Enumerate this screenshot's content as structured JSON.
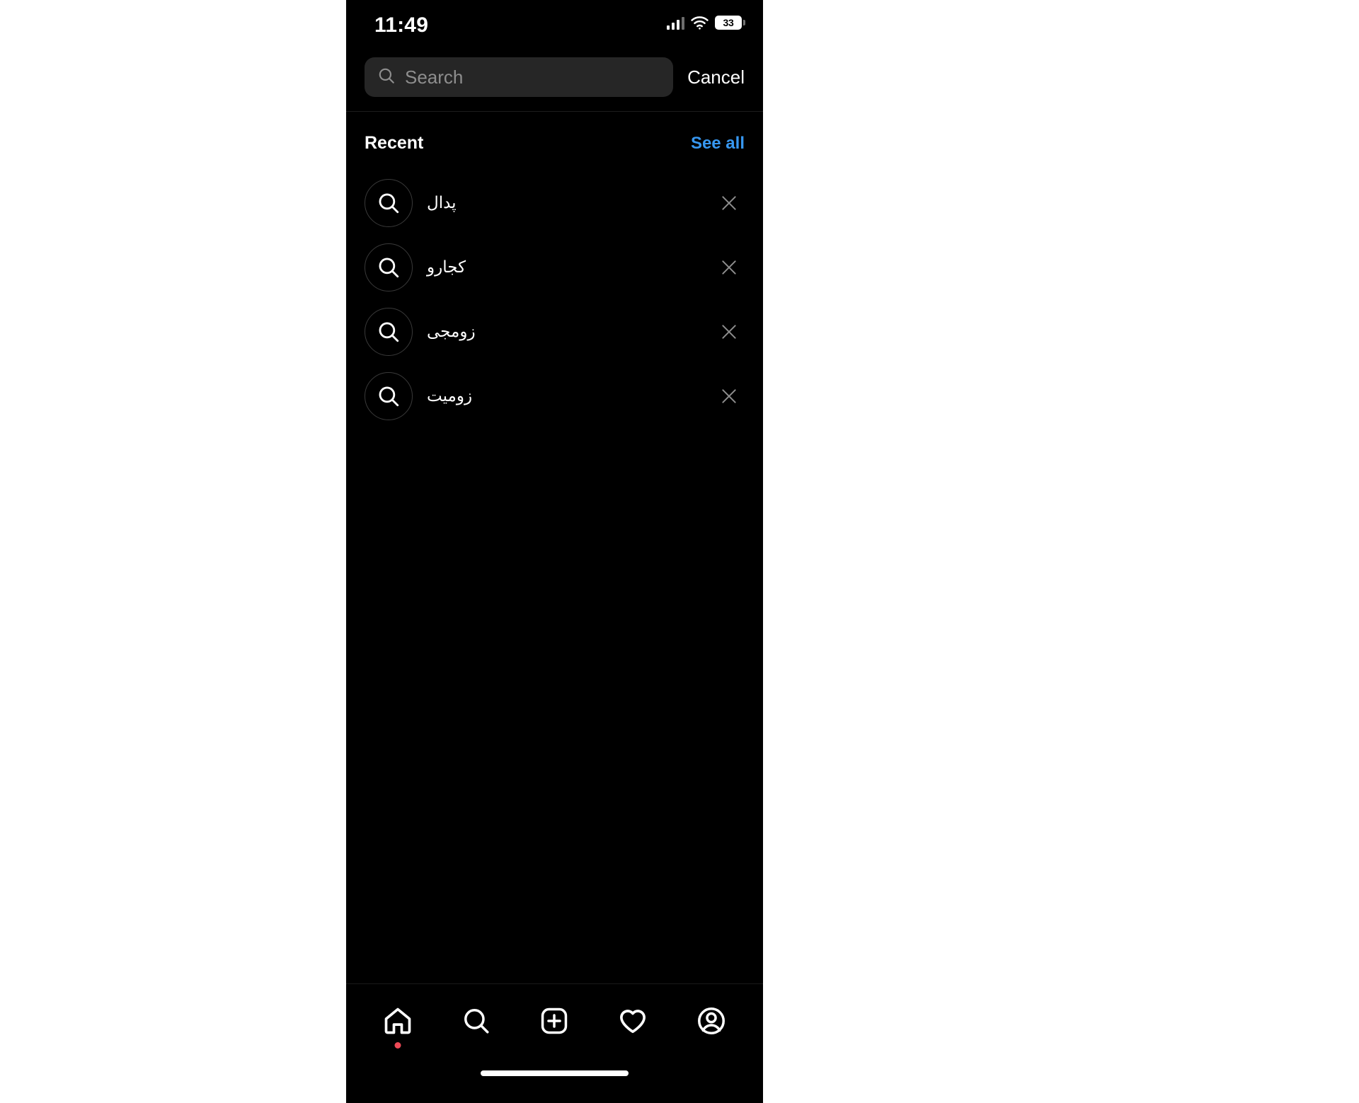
{
  "app": {
    "name": "Instagram",
    "screen": "search",
    "theme": "dark",
    "background_color": "#000000",
    "page_background": "#ffffff",
    "accent_color": "#3797f0",
    "notification_dot_color": "#ed4956"
  },
  "status_bar": {
    "time": "11:49",
    "signal_icon": "cellular-signal-icon",
    "wifi_icon": "wifi-icon",
    "battery_icon": "battery-icon",
    "battery_level": "33"
  },
  "search": {
    "placeholder": "Search",
    "value": "",
    "icon": "search-icon",
    "cancel_label": "Cancel"
  },
  "recent": {
    "title": "Recent",
    "see_all_label": "See all",
    "items": [
      {
        "label": "پدال",
        "icon": "search-icon",
        "remove_icon": "close-icon"
      },
      {
        "label": "کجارو",
        "icon": "search-icon",
        "remove_icon": "close-icon"
      },
      {
        "label": "زومجی",
        "icon": "search-icon",
        "remove_icon": "close-icon"
      },
      {
        "label": "زومیت",
        "icon": "search-icon",
        "remove_icon": "close-icon"
      }
    ]
  },
  "bottom_nav": {
    "items": [
      {
        "name": "home",
        "icon": "home-icon",
        "badge": true
      },
      {
        "name": "search",
        "icon": "search-icon",
        "badge": false
      },
      {
        "name": "create",
        "icon": "plus-square-icon",
        "badge": false
      },
      {
        "name": "activity",
        "icon": "heart-icon",
        "badge": false
      },
      {
        "name": "profile",
        "icon": "profile-avatar-icon",
        "badge": false
      }
    ],
    "home_indicator": "home-indicator"
  }
}
